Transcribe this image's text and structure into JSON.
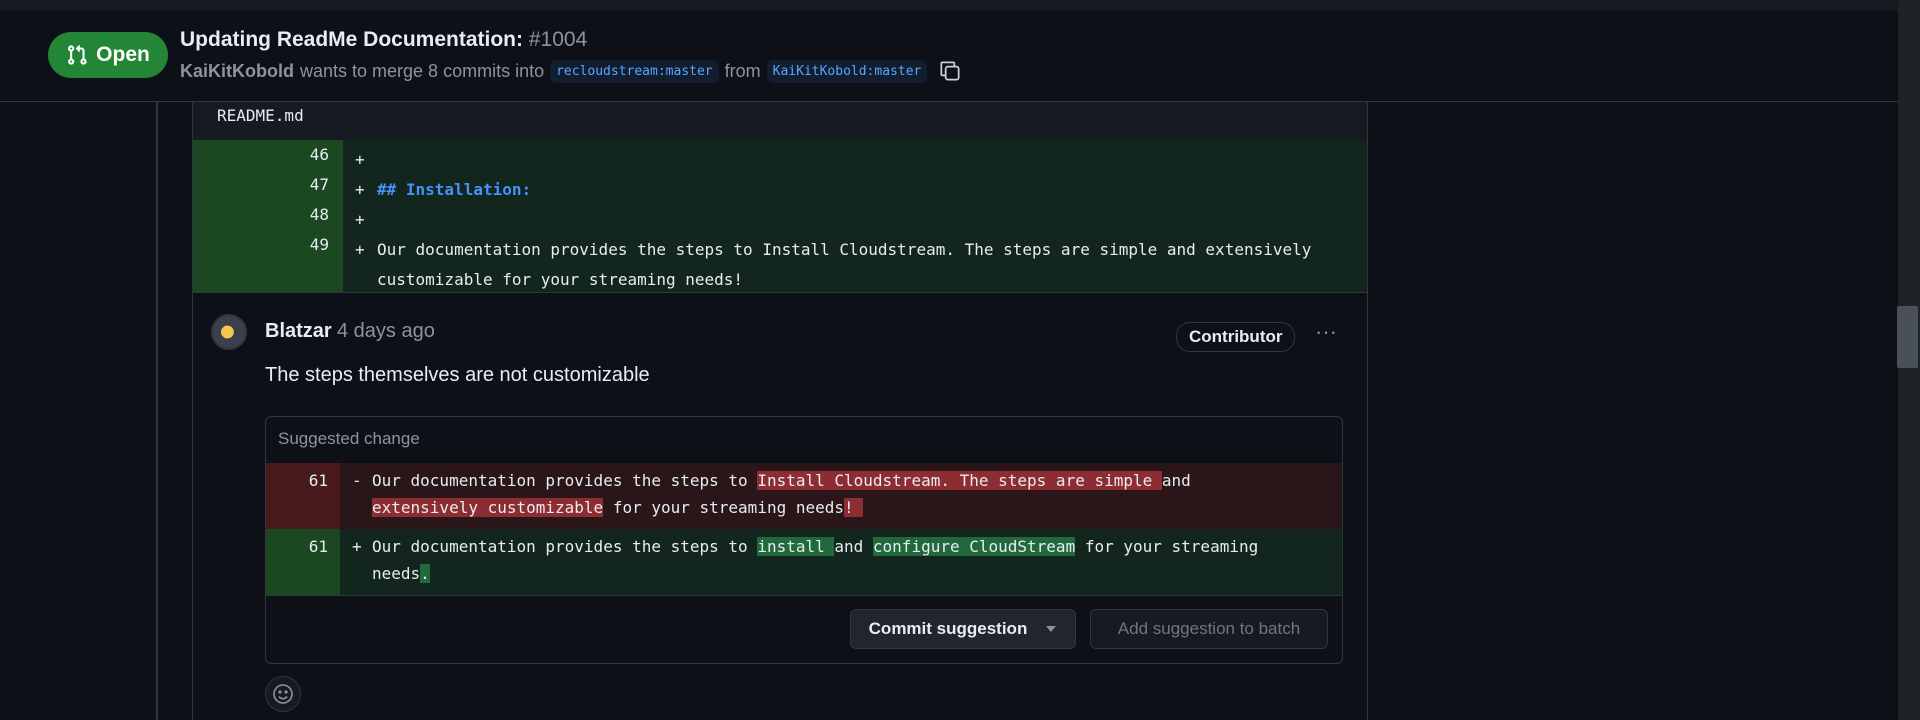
{
  "header": {
    "state": "Open",
    "title": "Updating ReadMe Documentation:",
    "number": "#1004",
    "author": "KaiKitKobold",
    "merge_text": "wants to merge 8 commits into",
    "base_branch": "recloudstream:master",
    "from_text": "from",
    "head_branch": "KaiKitKobold:master"
  },
  "file": {
    "name": "README.md",
    "lines": [
      {
        "num": "46",
        "marker": "+",
        "text": ""
      },
      {
        "num": "47",
        "marker": "+",
        "text": "## Installation:"
      },
      {
        "num": "48",
        "marker": "+",
        "text": ""
      },
      {
        "num": "49",
        "marker": "+",
        "text": "Our documentation provides the steps to Install Cloudstream. The steps are simple and extensively",
        "text2": "customizable for your streaming needs!"
      }
    ]
  },
  "comment": {
    "author": "Blatzar",
    "time": "4 days ago",
    "role": "Contributor",
    "more": "···",
    "body": "The steps themselves are not customizable",
    "suggestion": {
      "title": "Suggested change",
      "removed": {
        "num": "61",
        "marker": "-",
        "p1": "Our documentation provides the steps to ",
        "h1": "Install Cloudstream. The steps are simple ",
        "p2": "and",
        "h2": "extensively customizable",
        "p3": " for your streaming needs",
        "h3": "! "
      },
      "added": {
        "num": "61",
        "marker": "+",
        "p1": "Our documentation provides the steps to ",
        "h1": "install ",
        "p2": "and ",
        "h2": "configure CloudStream",
        "p3": " for your streaming",
        "p4": "needs",
        "h3": "."
      },
      "commit_label": "Commit suggestion",
      "batch_label": "Add suggestion to batch"
    }
  },
  "colors": {
    "open_badge": "#238636",
    "addition_bg": "#12261e",
    "deletion_bg": "#2a1619",
    "link": "#58a6ff"
  }
}
